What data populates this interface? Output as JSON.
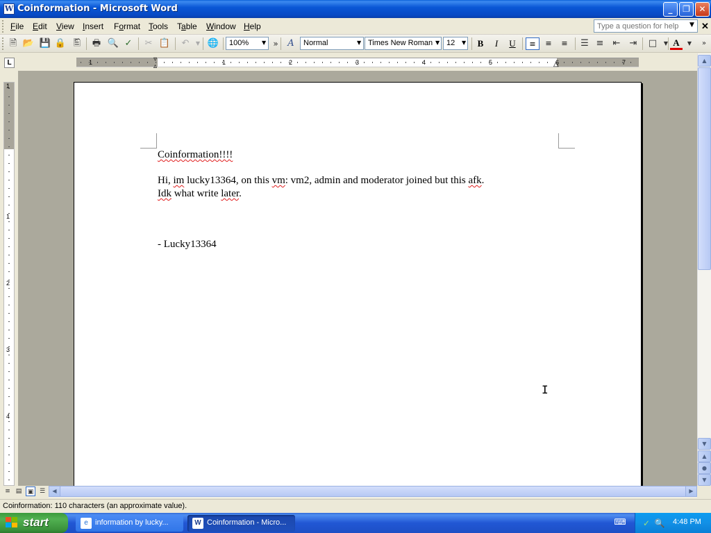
{
  "window": {
    "title": "Coinformation - Microsoft Word",
    "app_icon": "word-icon",
    "controls": [
      "minimize",
      "restore",
      "close"
    ]
  },
  "menubar": {
    "items": [
      {
        "label": "File",
        "accel": "F"
      },
      {
        "label": "Edit",
        "accel": "E"
      },
      {
        "label": "View",
        "accel": "V"
      },
      {
        "label": "Insert",
        "accel": "I"
      },
      {
        "label": "Format",
        "accel": "o"
      },
      {
        "label": "Tools",
        "accel": "T"
      },
      {
        "label": "Table",
        "accel": "a"
      },
      {
        "label": "Window",
        "accel": "W"
      },
      {
        "label": "Help",
        "accel": "H"
      }
    ],
    "help_placeholder": "Type a question for help"
  },
  "toolbar": {
    "zoom": "100%",
    "style": "Normal",
    "font": "Times New Roman",
    "size": "12",
    "bold": "B",
    "italic": "I",
    "underline": "U",
    "font_color_glyph": "A",
    "style_glyph": "A",
    "more_glyph": "»",
    "icons": [
      "new-document",
      "open",
      "save",
      "permission",
      "print-preview",
      "print",
      "spelling",
      "cut",
      "copy",
      "paste",
      "undo",
      "hyperlink",
      "align-left",
      "center",
      "align-right",
      "numbering",
      "bullets",
      "decrease-indent",
      "increase-indent",
      "borders",
      "font-color"
    ]
  },
  "ruler": {
    "horizontal_numbers": [
      "1",
      "1",
      "2",
      "3",
      "4",
      "5",
      "6",
      "7"
    ],
    "vertical_numbers": [
      "1",
      "1",
      "2",
      "3",
      "4"
    ],
    "tab_selector": "L"
  },
  "document": {
    "line1": "Coinformation!!!!",
    "line2_parts": [
      "Hi, ",
      "im",
      " lucky13364, on this ",
      "vm",
      ": vm2, admin and moderator joined but this ",
      "afk",
      "."
    ],
    "line3_parts": [
      "Idk",
      " what write ",
      "later",
      "."
    ],
    "signature": "- Lucky13364"
  },
  "statusbar": {
    "text": "Coinformation: 110 characters (an approximate value)."
  },
  "taskbar": {
    "start_label": "start",
    "tasks": [
      {
        "label": "information by lucky...",
        "icon": "ie-icon",
        "active": false
      },
      {
        "label": "Coinformation - Micro...",
        "icon": "word-icon",
        "active": true
      }
    ],
    "clock": "4:48 PM"
  }
}
